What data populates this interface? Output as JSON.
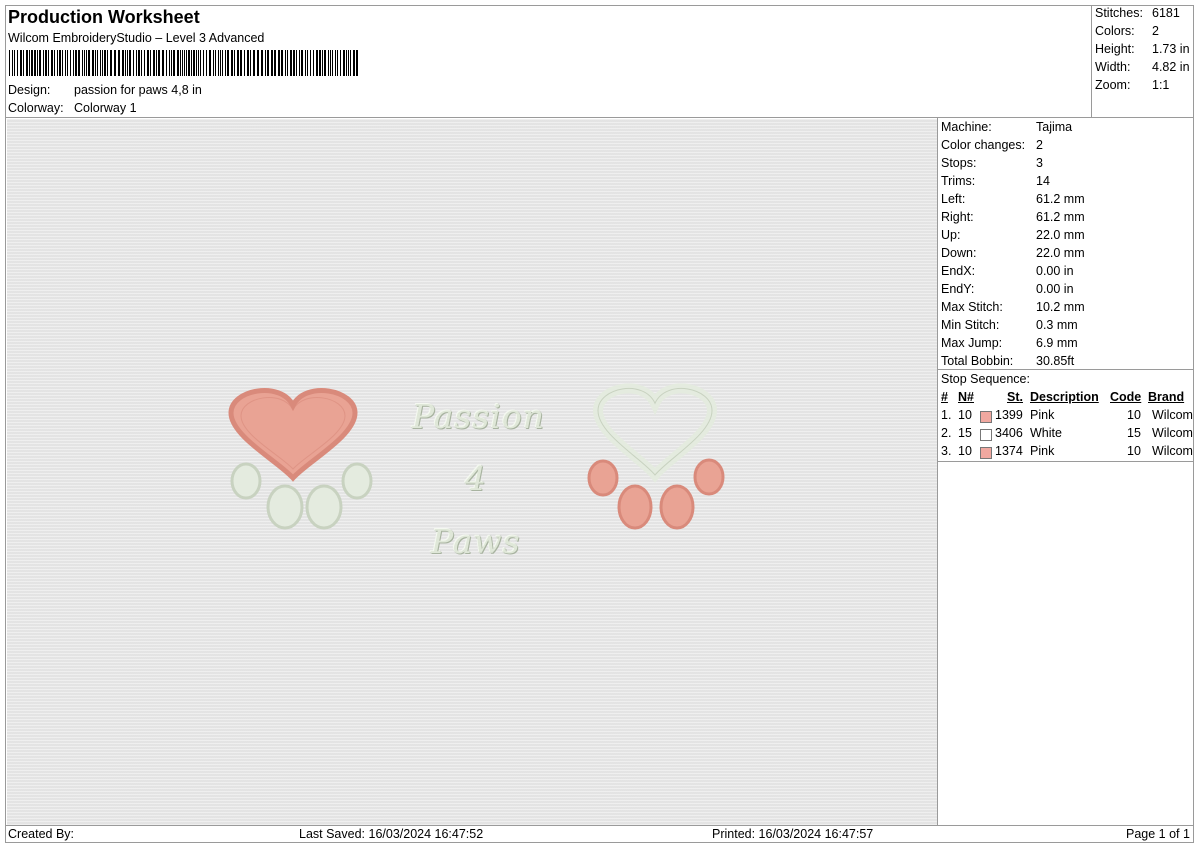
{
  "header": {
    "title": "Production Worksheet",
    "subtitle": "Wilcom EmbroideryStudio – Level 3 Advanced",
    "design_label": "Design:",
    "design_value": "passion for paws 4,8 in",
    "colorway_label": "Colorway:",
    "colorway_value": "Colorway 1"
  },
  "summary": [
    {
      "label": "Stitches:",
      "value": "6181"
    },
    {
      "label": "Colors:",
      "value": "2"
    },
    {
      "label": "Height:",
      "value": "1.73 in"
    },
    {
      "label": "Width:",
      "value": "4.82 in"
    },
    {
      "label": "Zoom:",
      "value": "1:1"
    }
  ],
  "machine_info": [
    {
      "label": "Machine:",
      "value": "Tajima"
    },
    {
      "label": "Color changes:",
      "value": "2"
    },
    {
      "label": "Stops:",
      "value": "3"
    },
    {
      "label": "Trims:",
      "value": "14"
    },
    {
      "label": "Left:",
      "value": "61.2 mm"
    },
    {
      "label": "Right:",
      "value": "61.2 mm"
    },
    {
      "label": "Up:",
      "value": "22.0 mm"
    },
    {
      "label": "Down:",
      "value": "22.0 mm"
    },
    {
      "label": "EndX:",
      "value": "0.00 in"
    },
    {
      "label": "EndY:",
      "value": "0.00 in"
    },
    {
      "label": "Max Stitch:",
      "value": "10.2 mm"
    },
    {
      "label": "Min Stitch:",
      "value": "0.3 mm"
    },
    {
      "label": "Max Jump:",
      "value": "6.9 mm"
    },
    {
      "label": "Total Bobbin:",
      "value": "30.85ft"
    }
  ],
  "stop_sequence": {
    "title": "Stop Sequence:",
    "headers": {
      "num": "#",
      "n": "N#",
      "st": "St.",
      "description": "Description",
      "code": "Code",
      "brand": "Brand"
    },
    "rows": [
      {
        "num": "1.",
        "n": "10",
        "st": "1399",
        "description": "Pink",
        "code": "10",
        "brand": "Wilcom",
        "color": "#f0a8a0"
      },
      {
        "num": "2.",
        "n": "15",
        "st": "3406",
        "description": "White",
        "code": "15",
        "brand": "Wilcom",
        "color": "#ffffff"
      },
      {
        "num": "3.",
        "n": "10",
        "st": "1374",
        "description": "Pink",
        "code": "10",
        "brand": "Wilcom",
        "color": "#f0a8a0"
      }
    ]
  },
  "design_text": {
    "line1": "Passion",
    "line2": "4",
    "line3": "Paws"
  },
  "colors": {
    "pink_fill": "#e9a394",
    "pink_edge": "#d98a7b",
    "white_fill": "#e4ebdf",
    "white_edge": "#c8d2c0"
  },
  "footer": {
    "created_by": "Created By:",
    "last_saved": "Last Saved: 16/03/2024 16:47:52",
    "printed": "Printed: 16/03/2024 16:47:57",
    "page": "Page 1 of 1"
  }
}
